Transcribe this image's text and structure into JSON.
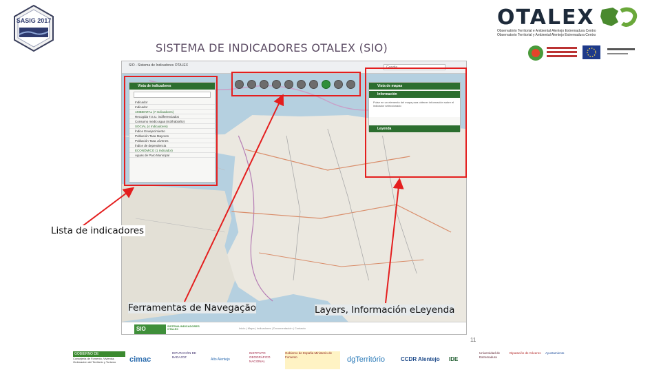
{
  "slide": {
    "title": "SISTEMA DE INDICADORES OTALEX (SIO)",
    "page_number": "11"
  },
  "badge": {
    "text": "SASIG 2017"
  },
  "otalex": {
    "wordmark": "OTALEX",
    "subtitle_lines": [
      "Observatório Territorial e Ambiental Alentejo Extremadura Centro",
      "Observatorio Territorial y Ambiental Alentejo Extremadura Centro"
    ]
  },
  "app": {
    "browser_tab": "SIO - Sistema de Indicadores OTALEX",
    "browser_search": "Google",
    "left_panel": {
      "header": "Vista de indicadores",
      "indicator_label": "Indicador",
      "rows": [
        {
          "text": "Indicador",
          "group": false
        },
        {
          "text": "AMBIENTAL (7 Indicadores)",
          "group": true
        },
        {
          "text": "Recogida T.S.U. indiferenciados",
          "group": false
        },
        {
          "text": "Consumo medio agua (m3/hab/año)",
          "group": false
        },
        {
          "text": "SOCIAL (4 Indicadores)",
          "group": true
        },
        {
          "text": "Índice Envejecimiento",
          "group": false
        },
        {
          "text": "Población Tasa Mayores",
          "group": false
        },
        {
          "text": "Población Tasa Jóvenes",
          "group": false
        },
        {
          "text": "Índice de dependencia",
          "group": false
        },
        {
          "text": "ECONÓMICO (1 Indicador)",
          "group": true
        },
        {
          "text": "Aguas de Paro Municipal",
          "group": false
        }
      ]
    },
    "right_panel": {
      "header_maps": "Vista de mapas",
      "header_info": "Información",
      "info_text": "Pulse en un elemento del mapa para obtener información sobre el indicador seleccionado",
      "header_legend": "Leyenda"
    },
    "footer": {
      "sio_logo": "SIO",
      "sio_caption": "SISTEMA INDICADORES OTALEX",
      "links": "Inicio  |  Mapa  |  Indicadores  |  Documentación  |  Contacto"
    }
  },
  "callouts": {
    "indicadores": "Lista de indicadores",
    "navegacao": "Ferramentas de Navegação",
    "layers": "Layers, Información eLeyenda"
  },
  "sponsors": [
    {
      "name": "GOBIERNO DE EXTREMADURA",
      "caption": "Consejería de Fomento, Vivienda, Ordenación del Territorio y Turismo"
    },
    {
      "name": "cimac"
    },
    {
      "name": "DIPUTACIÓN DE BADAJOZ"
    },
    {
      "name": "Alto Alentejo"
    },
    {
      "name": "INSTITUTO GEOGRÁFICO NACIONAL"
    },
    {
      "name": "Gobierno de España Ministerio de Fomento"
    },
    {
      "name": "dgTerritório"
    },
    {
      "name": "CCDR Alentejo"
    },
    {
      "name": "IDE"
    },
    {
      "name": "Universidad de Extremadura"
    },
    {
      "name": "Diputación de Cáceres"
    },
    {
      "name": "Ayuntamiento"
    }
  ],
  "colors": {
    "highlight": "#e41e1e",
    "panel_header": "#2c6e2f",
    "title": "#5b4b63",
    "otalex_green": "#6aa83a"
  }
}
